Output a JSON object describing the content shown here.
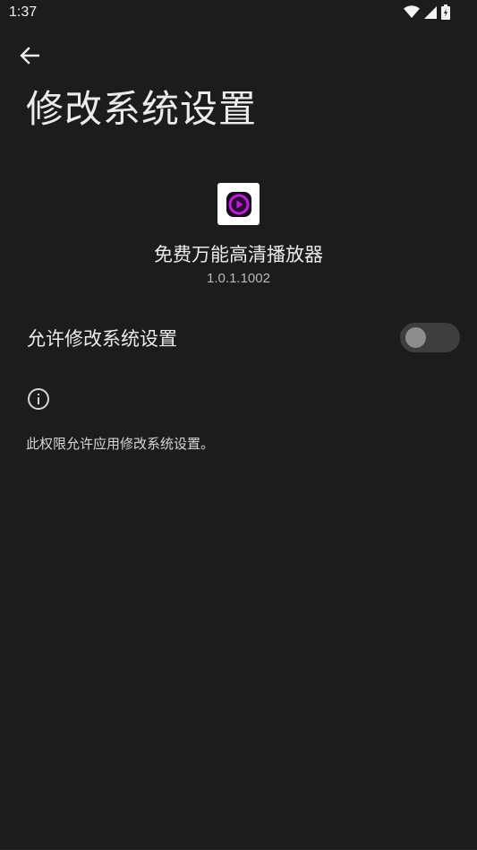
{
  "status_bar": {
    "time": "1:37",
    "icons": [
      "wifi-icon",
      "signal-icon",
      "battery-icon"
    ]
  },
  "header": {
    "back_icon": "arrow-back-icon",
    "title": "修改系统设置"
  },
  "app": {
    "name": "免费万能高清播放器",
    "version": "1.0.1.1002",
    "icon": "play-circle-icon",
    "icon_colors": {
      "ring": "#c11be2",
      "center": "#2a0a33"
    }
  },
  "permission": {
    "label": "允许修改系统设置",
    "enabled": false
  },
  "info": {
    "icon": "info-icon",
    "text": "此权限允许应用修改系统设置。"
  },
  "colors": {
    "background": "#1c1c1c",
    "text": "#ececec",
    "switch_track_off": "#3e3e3e",
    "switch_thumb_off": "#8d8d8d"
  }
}
